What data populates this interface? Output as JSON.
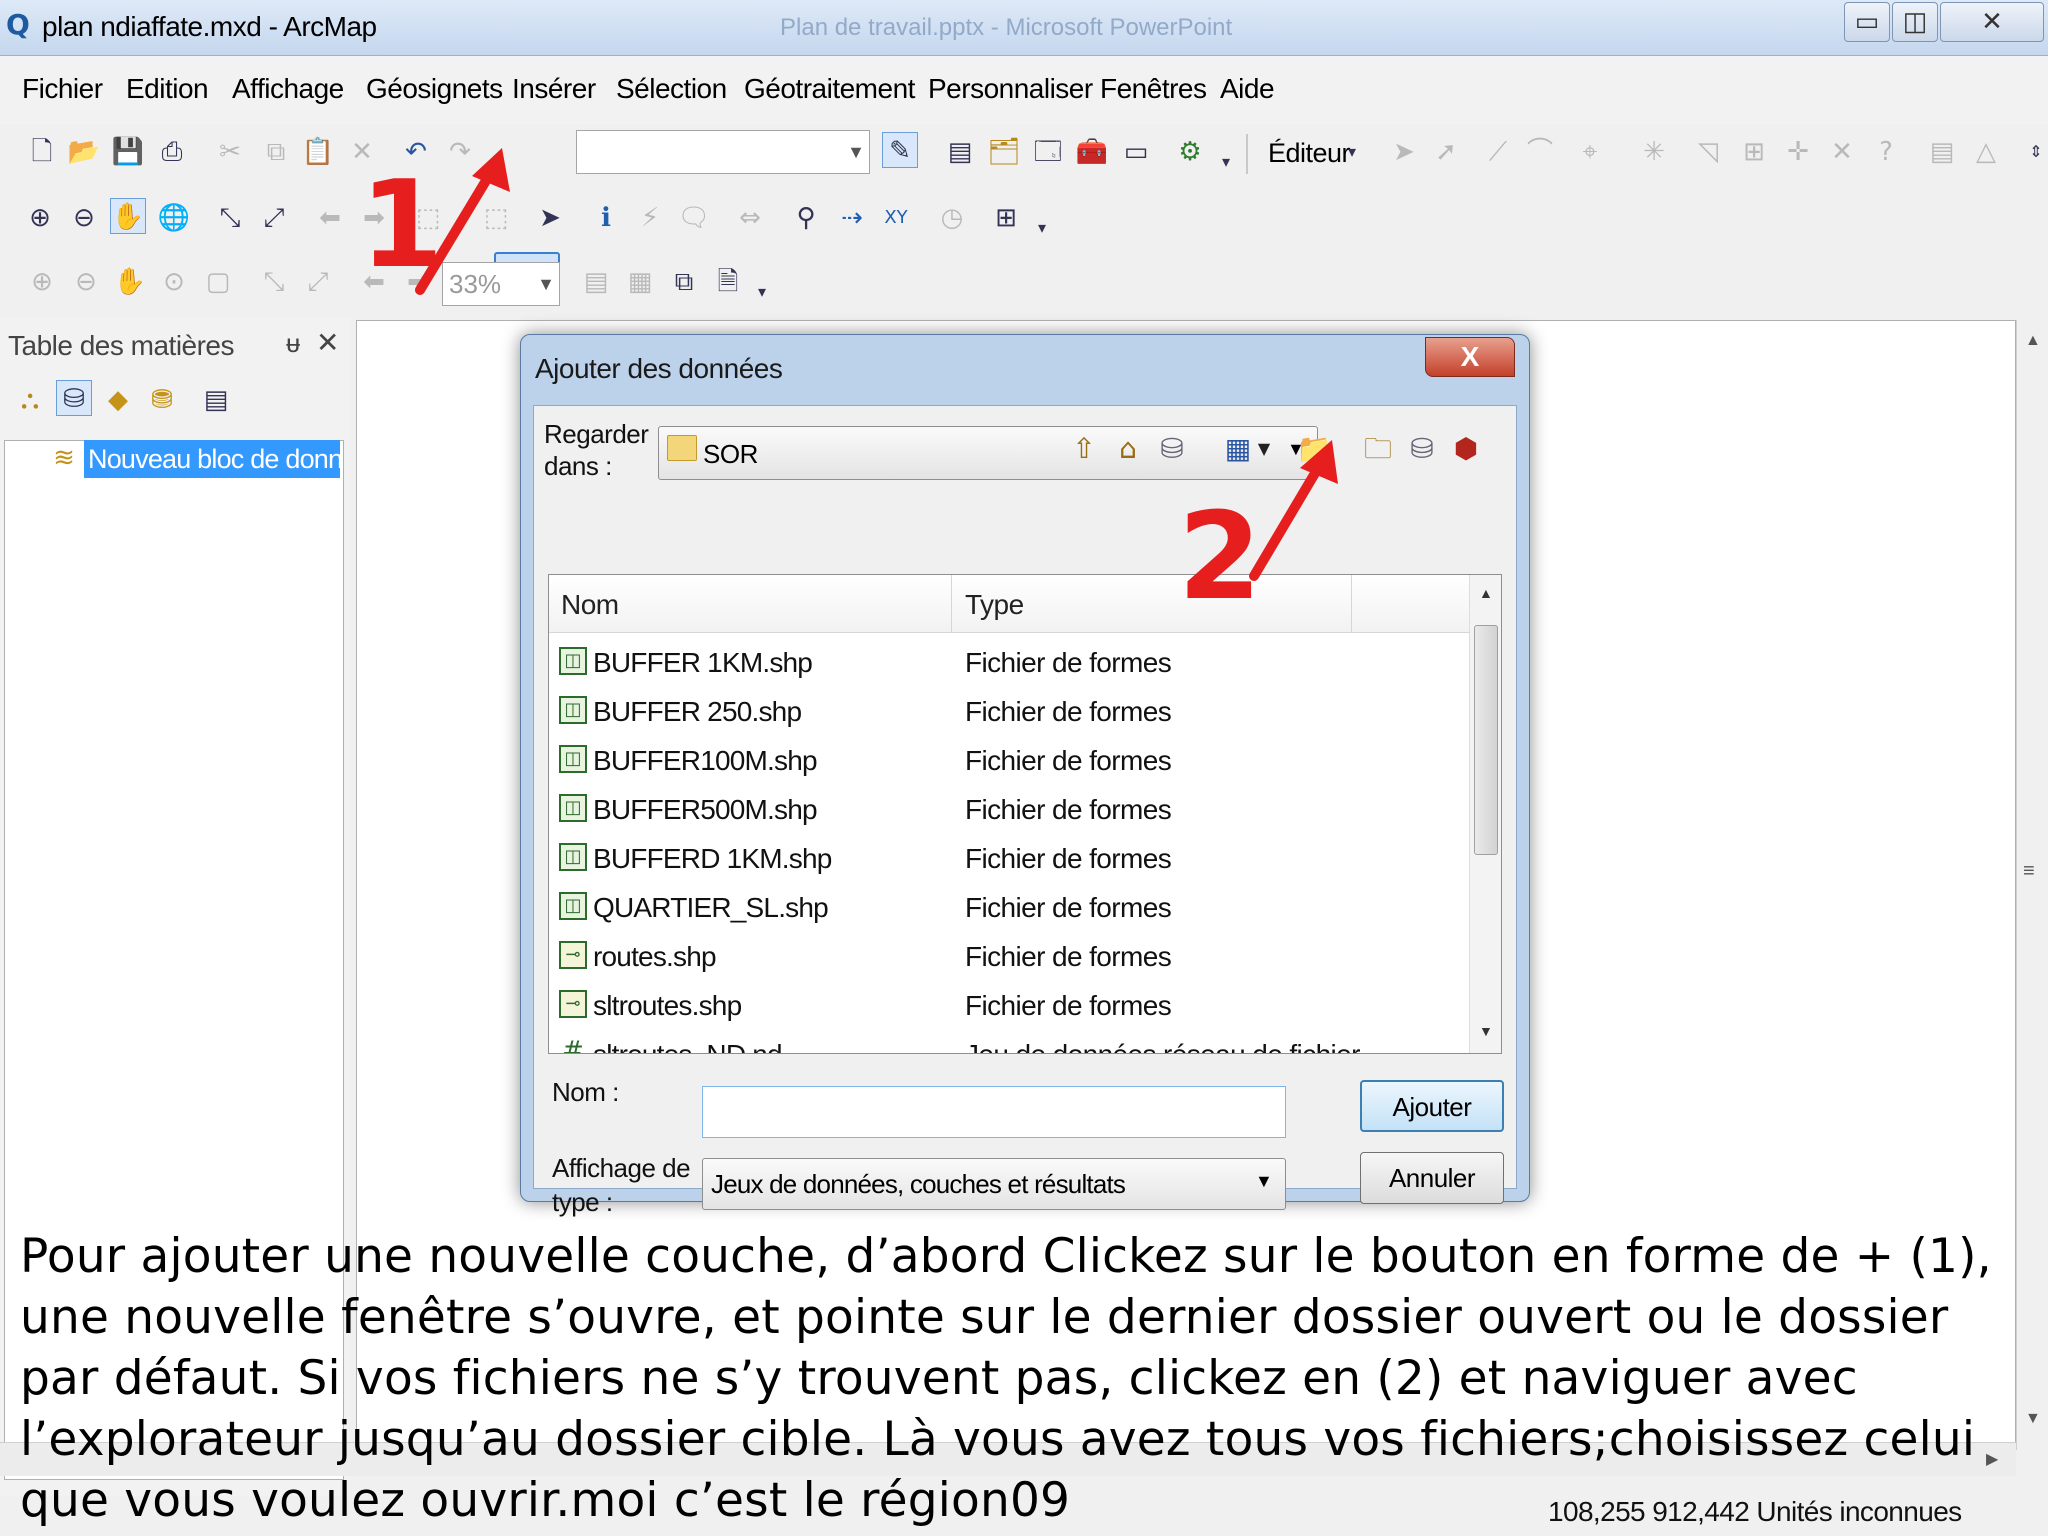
{
  "window": {
    "title": "plan ndiaffate.mxd - ArcMap",
    "background_title": "Plan de travail.pptx - Microsoft PowerPoint",
    "minimize": "▭",
    "maximize": "◫",
    "close": "✕"
  },
  "menu": [
    "Fichier",
    "Edition",
    "Affichage",
    "Géosignets",
    "Insérer",
    "Sélection",
    "Géotraitement",
    "Personnaliser",
    "Fenêtres",
    "Aide"
  ],
  "toolbar": {
    "editor_label": "Éditeur",
    "scale_value": "",
    "zoom_value": "33%"
  },
  "toc": {
    "title": "Table des matières",
    "pin": "ᵾ",
    "close": "✕",
    "layer_name": "Nouveau bloc de données"
  },
  "dialog": {
    "title": "Ajouter des données",
    "close": "X",
    "look_in_label_1": "Regarder",
    "look_in_label_2": "dans :",
    "look_in_value": "SOR",
    "columns": {
      "name": "Nom",
      "type": "Type"
    },
    "files": [
      {
        "name": "BUFFER 1KM.shp",
        "type": "Fichier de formes",
        "icon": "polygon-shapefile-icon"
      },
      {
        "name": "BUFFER 250.shp",
        "type": "Fichier de formes",
        "icon": "polygon-shapefile-icon"
      },
      {
        "name": "BUFFER100M.shp",
        "type": "Fichier de formes",
        "icon": "polygon-shapefile-icon"
      },
      {
        "name": "BUFFER500M.shp",
        "type": "Fichier de formes",
        "icon": "polygon-shapefile-icon"
      },
      {
        "name": "BUFFERD 1KM.shp",
        "type": "Fichier de formes",
        "icon": "polygon-shapefile-icon"
      },
      {
        "name": "QUARTIER_SL.shp",
        "type": "Fichier de formes",
        "icon": "polygon-shapefile-icon"
      },
      {
        "name": "routes.shp",
        "type": "Fichier de formes",
        "icon": "line-shapefile-icon"
      },
      {
        "name": "sltroutes.shp",
        "type": "Fichier de formes",
        "icon": "line-shapefile-icon"
      },
      {
        "name": "sltroutes_ND.nd",
        "type": "Jeu de données réseau de fichier",
        "icon": "network-dataset-icon"
      }
    ],
    "name_label": "Nom :",
    "name_value": "",
    "type_label_1": "Affichage de",
    "type_label_2": "type :",
    "type_value": "Jeux de données, couches et résultats",
    "add_button": "Ajouter",
    "cancel_button": "Annuler"
  },
  "status": {
    "coords": "108,255 912,442 Unités inconnues"
  },
  "annotations": {
    "num1": "1",
    "num2": "2",
    "color": "#e61e1e",
    "caption": "Pour ajouter une nouvelle couche, d’abord Clickez sur le bouton en forme de + (1), une nouvelle fenêtre s’ouvre, et pointe sur le dernier dossier ouvert ou le dossier par défaut. Si vos fichiers ne s’y trouvent pas, clickez en (2) et naviguer avec l’explorateur jusqu’au dossier cible. Là vous avez tous vos fichiers;choisissez celui que vous voulez ouvrir.moi c’est le région09"
  }
}
